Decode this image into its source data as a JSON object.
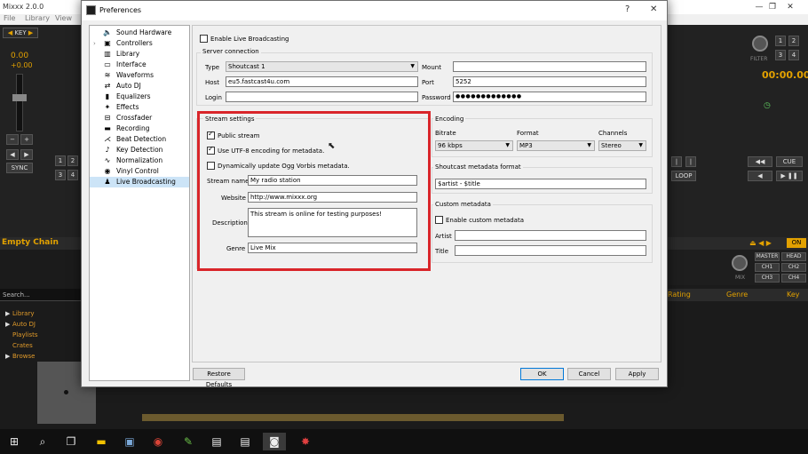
{
  "mixxx": {
    "title": "Mixxx 2.0.0",
    "menu": [
      "File",
      "Library",
      "View"
    ],
    "key_label": "KEY",
    "rate_value": "0.00",
    "rate_offset": "+0.00",
    "sync_label": "SYNC",
    "empty_chain": "Empty Chain",
    "search_placeholder": "Search...",
    "library_items": [
      "Library",
      "Auto DJ",
      "Playlists",
      "Crates",
      "Browse"
    ],
    "filter_label": "FILTER",
    "time": "00:00.00",
    "cue_label": "CUE",
    "loop_label": "LOOP",
    "on_label": "ON",
    "master_label": "MASTER",
    "head_label": "HEAD",
    "ch_labels": [
      "CH1",
      "CH2",
      "CH3",
      "CH4"
    ],
    "mix_label": "MIX",
    "hotcue_nums": [
      "1",
      "2",
      "3",
      "4"
    ],
    "columns": [
      "Rating",
      "Genre",
      "Key"
    ]
  },
  "dialog": {
    "title": "Preferences",
    "help": "?",
    "close": "✕",
    "tree": [
      {
        "label": "Sound Hardware",
        "icon": "speaker-icon"
      },
      {
        "label": "Controllers",
        "icon": "controller-icon"
      },
      {
        "label": "Library",
        "icon": "library-icon"
      },
      {
        "label": "Interface",
        "icon": "interface-icon"
      },
      {
        "label": "Waveforms",
        "icon": "waveform-icon"
      },
      {
        "label": "Auto DJ",
        "icon": "autodj-icon"
      },
      {
        "label": "Equalizers",
        "icon": "equalizer-icon"
      },
      {
        "label": "Effects",
        "icon": "effects-icon"
      },
      {
        "label": "Crossfader",
        "icon": "crossfader-icon"
      },
      {
        "label": "Recording",
        "icon": "recording-icon"
      },
      {
        "label": "Beat Detection",
        "icon": "beat-detection-icon"
      },
      {
        "label": "Key Detection",
        "icon": "key-detection-icon"
      },
      {
        "label": "Normalization",
        "icon": "normalization-icon"
      },
      {
        "label": "Vinyl Control",
        "icon": "vinyl-icon"
      },
      {
        "label": "Live Broadcasting",
        "icon": "broadcast-icon"
      }
    ],
    "enable_broadcasting": "Enable Live Broadcasting",
    "server_connection": {
      "title": "Server connection",
      "type_label": "Type",
      "type_value": "Shoutcast 1",
      "mount_label": "Mount",
      "mount_value": "",
      "host_label": "Host",
      "host_value": "eu5.fastcast4u.com",
      "port_label": "Port",
      "port_value": "5252",
      "login_label": "Login",
      "login_value": "",
      "password_label": "Password",
      "password_value": "●●●●●●●●●●●●●"
    },
    "stream_settings": {
      "title": "Stream settings",
      "public_stream": "Public stream",
      "utf8": "Use UTF-8 encoding for metadata.",
      "ogg": "Dynamically update Ogg Vorbis metadata.",
      "name_label": "Stream name",
      "name_value": "My radio station",
      "website_label": "Website",
      "website_value": "http://www.mixxx.org",
      "description_label": "Description",
      "description_value": "This stream is online for testing purposes!",
      "genre_label": "Genre",
      "genre_value": "Live Mix"
    },
    "encoding": {
      "title": "Encoding",
      "bitrate_label": "Bitrate",
      "bitrate_value": "96 kbps",
      "format_label": "Format",
      "format_value": "MP3",
      "channels_label": "Channels",
      "channels_value": "Stereo"
    },
    "shoutcast_metadata": {
      "title": "Shoutcast metadata format",
      "value": "$artist - $title"
    },
    "custom_metadata": {
      "title": "Custom metadata",
      "enable": "Enable custom metadata",
      "artist_label": "Artist",
      "artist_value": "",
      "title_label": "Title",
      "title_value": ""
    },
    "buttons": {
      "restore": "Restore Defaults",
      "ok": "OK",
      "cancel": "Cancel",
      "apply": "Apply"
    },
    "state": {
      "enable_broadcasting": false,
      "public_stream": true,
      "utf8": true,
      "ogg": false,
      "custom_metadata": false
    },
    "highlight_color": "#d9252a"
  }
}
